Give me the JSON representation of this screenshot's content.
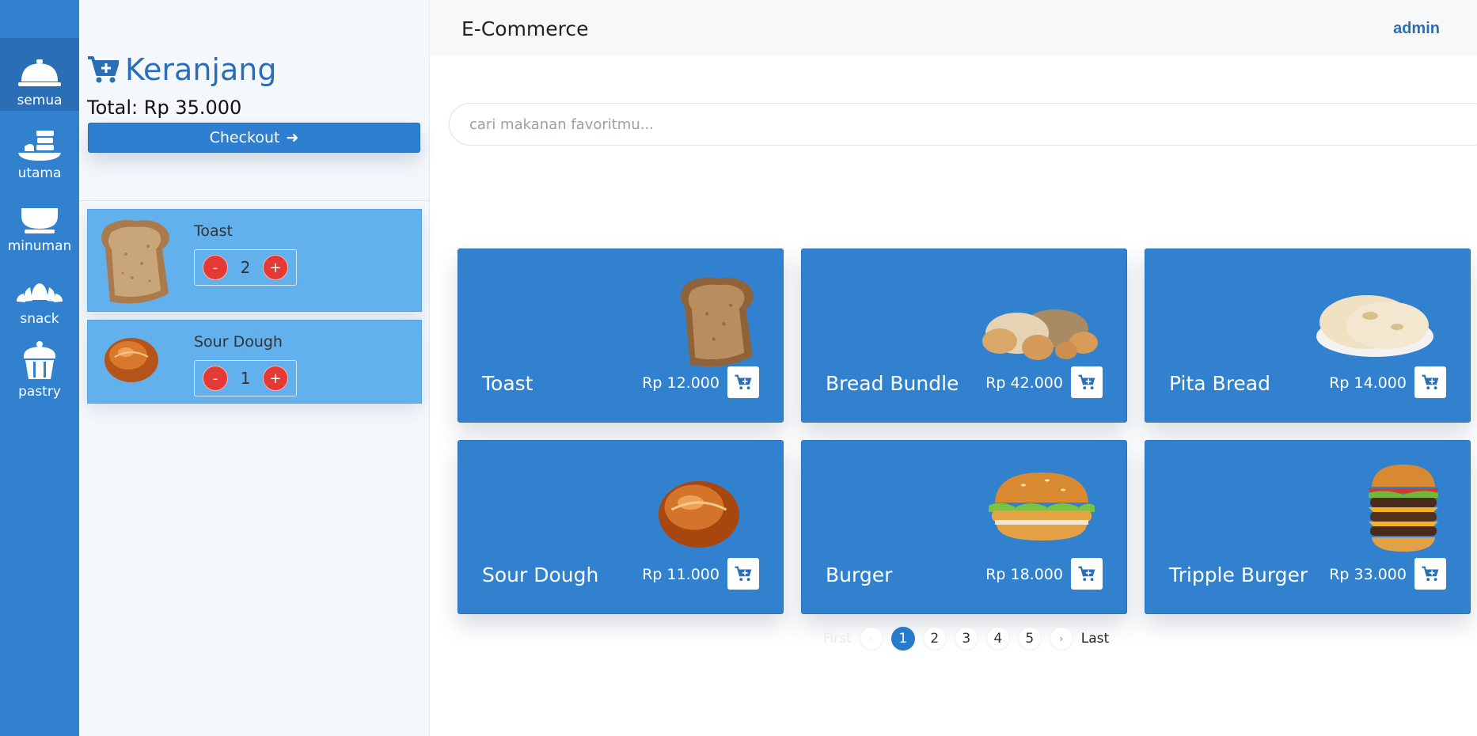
{
  "categories": [
    {
      "label": "semua",
      "icon": "cloche-icon",
      "active": true
    },
    {
      "label": "utama",
      "icon": "main-dish-icon",
      "active": false
    },
    {
      "label": "minuman",
      "icon": "bowl-icon",
      "active": false
    },
    {
      "label": "snack",
      "icon": "croissant-icon",
      "active": false
    },
    {
      "label": "pastry",
      "icon": "cupcake-icon",
      "active": false
    }
  ],
  "cart": {
    "title": "Keranjang",
    "total": "Total: Rp 35.000",
    "checkout_label": "Checkout",
    "items": [
      {
        "name": "Toast",
        "qty": "2",
        "minus": "-",
        "plus": "+"
      },
      {
        "name": "Sour Dough",
        "qty": "1",
        "minus": "-",
        "plus": "+"
      }
    ]
  },
  "header": {
    "brand": "E-Commerce",
    "user": "admin"
  },
  "search": {
    "placeholder": "cari makanan favoritmu..."
  },
  "products": [
    {
      "name": "Toast",
      "price": "Rp 12.000"
    },
    {
      "name": "Bread Bundle",
      "price": "Rp 42.000"
    },
    {
      "name": "Pita Bread",
      "price": "Rp 14.000"
    },
    {
      "name": "Sour Dough",
      "price": "Rp 11.000"
    },
    {
      "name": "Burger",
      "price": "Rp 18.000"
    },
    {
      "name": "Tripple Burger",
      "price": "Rp 33.000"
    }
  ],
  "pagination": {
    "first": "First",
    "last": "Last",
    "pages": [
      "1",
      "2",
      "3",
      "4",
      "5"
    ],
    "current": "1"
  },
  "colors": {
    "primary": "#3281cf",
    "cart_item": "#62b1ec",
    "qty_button": "#e53935",
    "accent_text": "#2a6fb6"
  }
}
